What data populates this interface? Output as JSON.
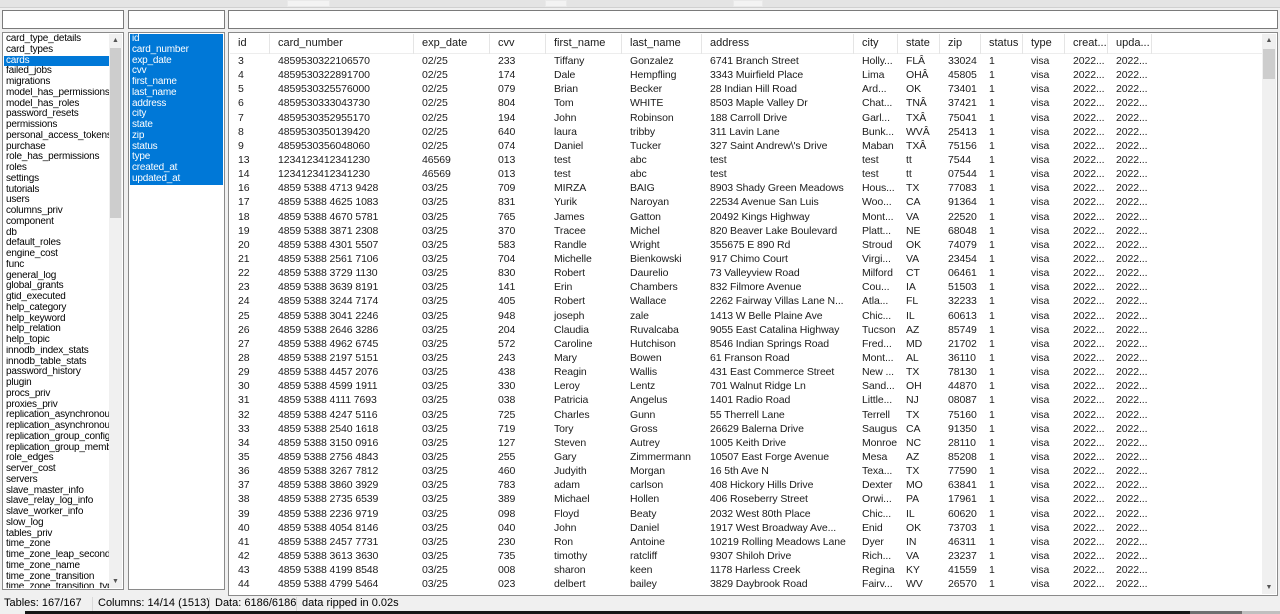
{
  "filters": {
    "tables_filter_value": "",
    "columns_filter_value": "",
    "data_filter_value": ""
  },
  "tables_panel": {
    "selected_index": 2,
    "items": [
      "card_type_details",
      "card_types",
      "cards",
      "failed_jobs",
      "migrations",
      "model_has_permissions",
      "model_has_roles",
      "password_resets",
      "permissions",
      "personal_access_tokens",
      "purchase",
      "role_has_permissions",
      "roles",
      "settings",
      "tutorials",
      "users",
      "columns_priv",
      "component",
      "db",
      "default_roles",
      "engine_cost",
      "func",
      "general_log",
      "global_grants",
      "gtid_executed",
      "help_category",
      "help_keyword",
      "help_relation",
      "help_topic",
      "innodb_index_stats",
      "innodb_table_stats",
      "password_history",
      "plugin",
      "procs_priv",
      "proxies_priv",
      "replication_asynchronous",
      "replication_asynchronous",
      "replication_group_configu",
      "replication_group_membe",
      "role_edges",
      "server_cost",
      "servers",
      "slave_master_info",
      "slave_relay_log_info",
      "slave_worker_info",
      "slow_log",
      "tables_priv",
      "time_zone",
      "time_zone_leap_second",
      "time_zone_name",
      "time_zone_transition",
      "time_zone_transition_typ"
    ]
  },
  "columns_panel": {
    "all_selected": true,
    "items": [
      "id",
      "card_number",
      "exp_date",
      "cvv",
      "first_name",
      "last_name",
      "address",
      "city",
      "state",
      "zip",
      "status",
      "type",
      "created_at",
      "updated_at"
    ]
  },
  "grid": {
    "headers": [
      "id",
      "card_number",
      "exp_date",
      "cvv",
      "first_name",
      "last_name",
      "address",
      "city",
      "state",
      "zip",
      "status",
      "type",
      "creat...",
      "upda..."
    ],
    "rows": [
      [
        "3",
        "4859530322106570",
        "02/25",
        "233",
        "Tiffany",
        "Gonzalez",
        "6741 Branch Street",
        "Holly...",
        "FLÂ",
        "33024",
        "1",
        "visa",
        "2022...",
        "2022..."
      ],
      [
        "4",
        "4859530322891700",
        "02/25",
        "174",
        "Dale",
        "Hempfling",
        "3343 Muirfield Place",
        "Lima",
        "OHÂ",
        "45805",
        "1",
        "visa",
        "2022...",
        "2022..."
      ],
      [
        "5",
        "4859530325576000",
        "02/25",
        "079",
        "Brian",
        "Becker",
        "28 Indian Hill Road",
        "Ard...",
        "OK",
        "73401",
        "1",
        "visa",
        "2022...",
        "2022..."
      ],
      [
        "6",
        "4859530333043730",
        "02/25",
        "804",
        "Tom",
        "WHITE",
        "8503 Maple Valley Dr",
        "Chat...",
        "TNÂ",
        "37421",
        "1",
        "visa",
        "2022...",
        "2022..."
      ],
      [
        "7",
        "4859530352955170",
        "02/25",
        "194",
        "John",
        "Robinson",
        "188 Carroll Drive",
        "Garl...",
        "TXÂ",
        "75041",
        "1",
        "visa",
        "2022...",
        "2022..."
      ],
      [
        "8",
        "4859530350139420",
        "02/25",
        "640",
        "laura",
        "tribby",
        "311 Lavin Lane",
        "Bunk...",
        "WVÂ",
        "25413",
        "1",
        "visa",
        "2022...",
        "2022..."
      ],
      [
        "9",
        "4859530356048060",
        "02/25",
        "074",
        "Daniel",
        "Tucker",
        "327 Saint Andrew\\'s Drive",
        "Maban",
        "TXÂ",
        "75156",
        "1",
        "visa",
        "2022...",
        "2022..."
      ],
      [
        "13",
        "1234123412341230",
        "46569",
        "013",
        "test",
        "abc",
        "test",
        "test",
        "tt",
        "7544",
        "1",
        "visa",
        "2022...",
        "2022..."
      ],
      [
        "14",
        "1234123412341230",
        "46569",
        "013",
        "test",
        "abc",
        "test",
        "test",
        "tt",
        "07544",
        "1",
        "visa",
        "2022...",
        "2022..."
      ],
      [
        "16",
        "4859 5388 4713 9428",
        "03/25",
        "709",
        "MIRZA",
        "BAIG",
        "8903 Shady Green Meadows",
        "Hous...",
        "TX",
        "77083",
        "1",
        "visa",
        "2022...",
        "2022..."
      ],
      [
        "17",
        "4859 5388 4625 1083",
        "03/25",
        "831",
        "Yurik",
        "Naroyan",
        "22534 Avenue San Luis",
        "Woo...",
        "CA",
        "91364",
        "1",
        "visa",
        "2022...",
        "2022..."
      ],
      [
        "18",
        "4859 5388 4670 5781",
        "03/25",
        "765",
        "James",
        "Gatton",
        "20492 Kings Highway",
        "Mont...",
        "VA",
        "22520",
        "1",
        "visa",
        "2022...",
        "2022..."
      ],
      [
        "19",
        "4859 5388 3871 2308",
        "03/25",
        "370",
        "Tracee",
        "Michel",
        "820 Beaver Lake Boulevard",
        "Platt...",
        "NE",
        "68048",
        "1",
        "visa",
        "2022...",
        "2022..."
      ],
      [
        "20",
        "4859 5388 4301 5507",
        "03/25",
        "583",
        "Randle",
        "Wright",
        "355675 E 890 Rd",
        "Stroud",
        "OK",
        "74079",
        "1",
        "visa",
        "2022...",
        "2022..."
      ],
      [
        "21",
        "4859 5388 2561 7106",
        "03/25",
        "704",
        "Michelle",
        "Bienkowski",
        "917 Chimo Court",
        "Virgi...",
        "VA",
        "23454",
        "1",
        "visa",
        "2022...",
        "2022..."
      ],
      [
        "22",
        "4859 5388 3729 1130",
        "03/25",
        "830",
        "Robert",
        "Daurelio",
        "73 Valleyview Road",
        "Milford",
        "CT",
        "06461",
        "1",
        "visa",
        "2022...",
        "2022..."
      ],
      [
        "23",
        "4859 5388 3639 8191",
        "03/25",
        "141",
        "Erin",
        "Chambers",
        "832 Filmore Avenue",
        "Cou...",
        "IA",
        "51503",
        "1",
        "visa",
        "2022...",
        "2022..."
      ],
      [
        "24",
        "4859 5388 3244 7174",
        "03/25",
        "405",
        "Robert",
        "Wallace",
        "2262 Fairway Villas Lane N...",
        "Atla...",
        "FL",
        "32233",
        "1",
        "visa",
        "2022...",
        "2022..."
      ],
      [
        "25",
        "4859 5388 3041 2246",
        "03/25",
        "948",
        "joseph",
        "zale",
        "1413 W Belle Plaine Ave",
        "Chic...",
        "IL",
        "60613",
        "1",
        "visa",
        "2022...",
        "2022..."
      ],
      [
        "26",
        "4859 5388 2646 3286",
        "03/25",
        "204",
        "Claudia",
        "Ruvalcaba",
        "9055 East Catalina Highway",
        "Tucson",
        "AZ",
        "85749",
        "1",
        "visa",
        "2022...",
        "2022..."
      ],
      [
        "27",
        "4859 5388 4962 6745",
        "03/25",
        "572",
        "Caroline",
        "Hutchison",
        "8546 Indian Springs Road",
        "Fred...",
        "MD",
        "21702",
        "1",
        "visa",
        "2022...",
        "2022..."
      ],
      [
        "28",
        "4859 5388 2197 5151",
        "03/25",
        "243",
        "Mary",
        "Bowen",
        "61 Franson Road",
        "Mont...",
        "AL",
        "36110",
        "1",
        "visa",
        "2022...",
        "2022..."
      ],
      [
        "29",
        "4859 5388 4457 2076",
        "03/25",
        "438",
        "Reagin",
        "Wallis",
        "431 East Commerce Street",
        "New ...",
        "TX",
        "78130",
        "1",
        "visa",
        "2022...",
        "2022..."
      ],
      [
        "30",
        "4859 5388 4599 1911",
        "03/25",
        "330",
        "Leroy",
        "Lentz",
        "701 Walnut Ridge Ln",
        "Sand...",
        "OH",
        "44870",
        "1",
        "visa",
        "2022...",
        "2022..."
      ],
      [
        "31",
        "4859 5388 4111 7693",
        "03/25",
        "038",
        "Patricia",
        "Angelus",
        "1401 Radio Road",
        "Little...",
        "NJ",
        "08087",
        "1",
        "visa",
        "2022...",
        "2022..."
      ],
      [
        "32",
        "4859 5388 4247 5116",
        "03/25",
        "725",
        "Charles",
        "Gunn",
        "55 Therrell Lane",
        "Terrell",
        "TX",
        "75160",
        "1",
        "visa",
        "2022...",
        "2022..."
      ],
      [
        "33",
        "4859 5388 2540 1618",
        "03/25",
        "719",
        "Tory",
        "Gross",
        "26629 Balerna Drive",
        "Saugus",
        "CA",
        "91350",
        "1",
        "visa",
        "2022...",
        "2022..."
      ],
      [
        "34",
        "4859 5388 3150 0916",
        "03/25",
        "127",
        "Steven",
        "Autrey",
        "1005 Keith Drive",
        "Monroe",
        "NC",
        "28110",
        "1",
        "visa",
        "2022...",
        "2022..."
      ],
      [
        "35",
        "4859 5388 2756 4843",
        "03/25",
        "255",
        "Gary",
        "Zimmermann",
        "10507 East Forge Avenue",
        "Mesa",
        "AZ",
        "85208",
        "1",
        "visa",
        "2022...",
        "2022..."
      ],
      [
        "36",
        "4859 5388 3267 7812",
        "03/25",
        "460",
        "Judyith",
        "Morgan",
        "16 5th Ave N",
        "Texa...",
        "TX",
        "77590",
        "1",
        "visa",
        "2022...",
        "2022..."
      ],
      [
        "37",
        "4859 5388 3860 3929",
        "03/25",
        "783",
        "adam",
        "carlson",
        "408 Hickory Hills Drive",
        "Dexter",
        "MO",
        "63841",
        "1",
        "visa",
        "2022...",
        "2022..."
      ],
      [
        "38",
        "4859 5388 2735 6539",
        "03/25",
        "389",
        "Michael",
        "Hollen",
        "406 Roseberry Street",
        "Orwi...",
        "PA",
        "17961",
        "1",
        "visa",
        "2022...",
        "2022..."
      ],
      [
        "39",
        "4859 5388 2236 9719",
        "03/25",
        "098",
        "Floyd",
        "Beaty",
        "2032 West 80th Place",
        "Chic...",
        "IL",
        "60620",
        "1",
        "visa",
        "2022...",
        "2022..."
      ],
      [
        "40",
        "4859 5388 4054 8146",
        "03/25",
        "040",
        "John",
        "Daniel",
        "1917 West Broadway Ave...",
        "Enid",
        "OK",
        "73703",
        "1",
        "visa",
        "2022...",
        "2022..."
      ],
      [
        "41",
        "4859 5388 2457 7731",
        "03/25",
        "230",
        "Ron",
        "Antoine",
        "10219 Rolling Meadows Lane",
        "Dyer",
        "IN",
        "46311",
        "1",
        "visa",
        "2022...",
        "2022..."
      ],
      [
        "42",
        "4859 5388 3613 3630",
        "03/25",
        "735",
        "timothy",
        "ratcliff",
        "9307 Shiloh Drive",
        "Rich...",
        "VA",
        "23237",
        "1",
        "visa",
        "2022...",
        "2022..."
      ],
      [
        "43",
        "4859 5388 4199 8548",
        "03/25",
        "008",
        "sharon",
        "keen",
        "1178 Harless Creek",
        "Regina",
        "KY",
        "41559",
        "1",
        "visa",
        "2022...",
        "2022..."
      ],
      [
        "44",
        "4859 5388 4799 5464",
        "03/25",
        "023",
        "delbert",
        "bailey",
        "3829 Daybrook Road",
        "Fairv...",
        "WV",
        "26570",
        "1",
        "visa",
        "2022...",
        "2022..."
      ]
    ]
  },
  "status_bar": {
    "tables": "Tables: 167/167",
    "columns": "Columns: 14/14 (1513)",
    "data": "Data: 6186/6186",
    "message": "data ripped in 0.02s"
  },
  "icons": {
    "scroll_up": "▲",
    "scroll_down": "▼"
  },
  "colors": {
    "selection": "#0078d7",
    "panel_border": "#8a8a8a",
    "scroll_thumb": "#cdcdcd"
  }
}
